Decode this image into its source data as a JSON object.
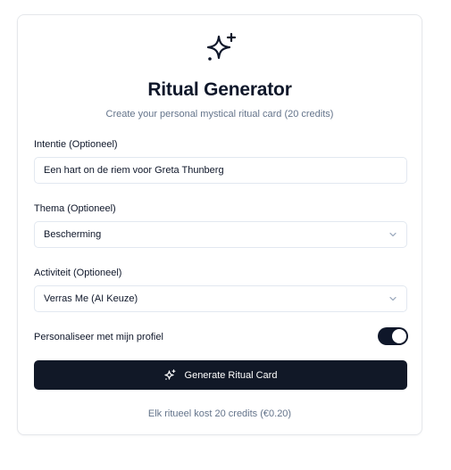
{
  "header": {
    "icon": "sparkles-icon",
    "title": "Ritual Generator",
    "subtitle": "Create your personal mystical ritual card (20 credits)"
  },
  "form": {
    "intent": {
      "label": "Intentie (Optioneel)",
      "value": "Een hart on de riem voor Greta Thunberg"
    },
    "theme": {
      "label": "Thema (Optioneel)",
      "selected": "Bescherming"
    },
    "activity": {
      "label": "Activiteit (Optioneel)",
      "selected": "Verras Me (AI Keuze)"
    },
    "personalize": {
      "label": "Personaliseer met mijn profiel",
      "enabled": true
    }
  },
  "actions": {
    "generate_label": "Generate Ritual Card"
  },
  "footer": {
    "note": "Elk ritueel kost 20 credits (€0.20)"
  },
  "colors": {
    "primary": "#111827",
    "muted_text": "#64748b",
    "border": "#e2e8f0"
  }
}
